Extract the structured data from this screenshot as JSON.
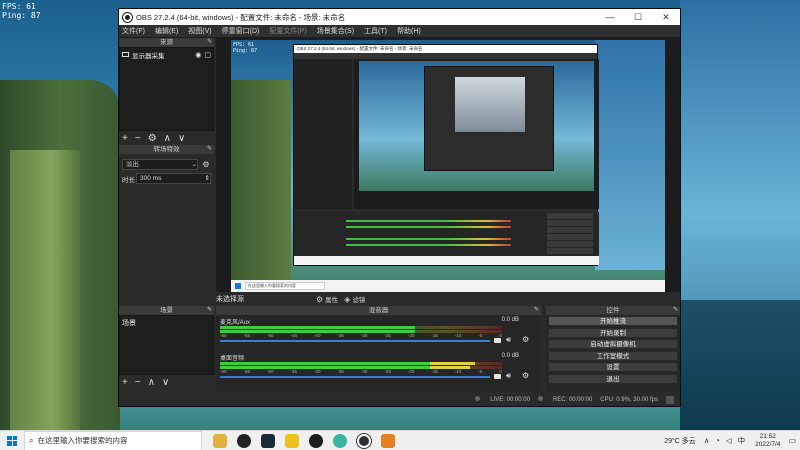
{
  "overlay": {
    "fps_line": "FPS: 61",
    "ping_line": "Ping: 87"
  },
  "window": {
    "title": "OBS 27.2.4 (64-bit, windows) - 配置文件: 未命名 - 场景: 未命名",
    "min": "—",
    "max": "☐",
    "close": "✕"
  },
  "menu": [
    "文件(F)",
    "编辑(E)",
    "视图(V)",
    "停靠窗口(D)",
    "配置文件(P)",
    "场景集合(S)",
    "工具(T)",
    "帮助(H)"
  ],
  "sources": {
    "header": "来源",
    "items": [
      {
        "label": "显示器采集"
      }
    ],
    "toolbar": [
      "+",
      "−",
      "⚙",
      "∧",
      "∨"
    ]
  },
  "transitions": {
    "header": "转场特效",
    "selected": "淡出",
    "duration_label": "时长",
    "duration_value": "300 ms"
  },
  "preview": {
    "fps_line": "FPS: 61",
    "ping_line": "Ping: 87",
    "nested_title": "OBS 27.2.4 (64-bit, windows) - 配置文件: 未命名 - 场景: 未命名",
    "search_placeholder": "在这里输入你要搜索的内容"
  },
  "scene_strip": {
    "current": "未选择源",
    "properties": "属性",
    "filters": "滤镜"
  },
  "scenes": {
    "header": "场景",
    "items": [
      "场景"
    ],
    "toolbar": [
      "+",
      "−",
      "∧",
      "∨"
    ]
  },
  "mixer": {
    "header": "混音器",
    "tracks": [
      {
        "name": "麦克风/Aux",
        "db": "0.0 dB"
      },
      {
        "name": "桌面音频",
        "db": "0.0 dB"
      }
    ],
    "scale": [
      "-60",
      "-55",
      "-50",
      "-45",
      "-40",
      "-35",
      "-30",
      "-25",
      "-20",
      "-15",
      "-10",
      "-5",
      "0"
    ]
  },
  "controls": {
    "header": "控件",
    "buttons": [
      "开始推流",
      "开始录制",
      "启动虚拟摄像机",
      "工作室模式",
      "设置",
      "退出"
    ]
  },
  "status": {
    "live": "LIVE: 00:00:00",
    "rec": "REC: 00:00:00",
    "cpu": "CPU: 0.9%, 30.00 fps"
  },
  "taskbar": {
    "search_placeholder": "在这里输入你要搜索的内容",
    "weather": "29°C 多云",
    "time": "21:52",
    "date": "2022/7/4",
    "lang": "中"
  }
}
